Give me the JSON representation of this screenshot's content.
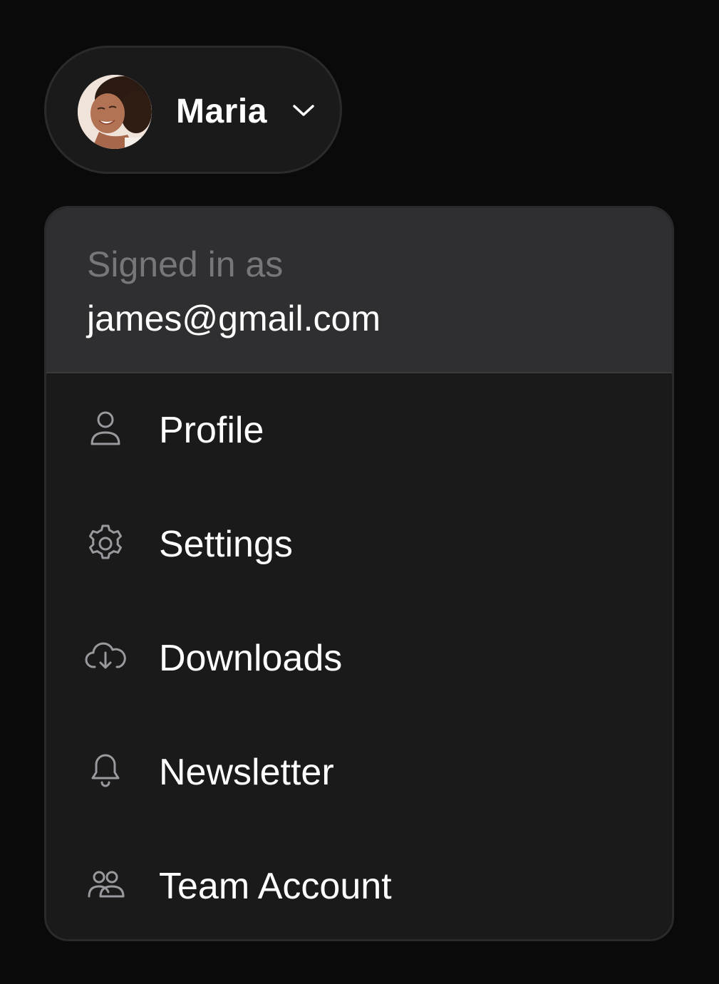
{
  "user": {
    "name": "Maria",
    "avatar_icon": "user-avatar-photo",
    "chevron_icon": "chevron-down-icon"
  },
  "menu": {
    "signed_in_label": "Signed in as",
    "email": "james@gmail.com",
    "items": [
      {
        "label": "Profile",
        "icon": "user-icon"
      },
      {
        "label": "Settings",
        "icon": "gear-icon"
      },
      {
        "label": "Downloads",
        "icon": "cloud-download-icon"
      },
      {
        "label": "Newsletter",
        "icon": "bell-icon"
      },
      {
        "label": "Team Account",
        "icon": "users-icon"
      }
    ]
  },
  "colors": {
    "background": "#0a0a0a",
    "surface": "#1a1a1b",
    "header_surface": "#2f2f31",
    "muted_text": "#77777b",
    "text": "#ffffff",
    "icon": "#9a9a9e"
  }
}
